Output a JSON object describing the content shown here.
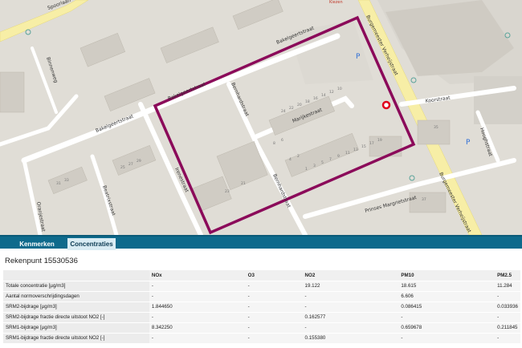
{
  "map": {
    "streets": {
      "bakelgeertstraat_top": "Bakelgeertstraat",
      "bakelgeertstraat_mid": "Bakelgeertstraat",
      "bakelgeertstraat_left": "Bakelgeertstraat",
      "bernhardstraat": "Bernhardstraat",
      "bernhardstraat_south": "Bernhardstraat",
      "marijkestraat": "Marijkestraat",
      "burgemeester_verheijstraat_north": "Burgemeester Verheijstraat",
      "burgemeester_verheijstraat_south": "Burgemeester Verheijstraat",
      "koorstraat": "Koorstraat",
      "prinses_margrietstraat": "Prinses Margrietstraat",
      "irenestraat": "Irenestraat",
      "beatrixstraat": "Beatrixstraat",
      "oranjestraat": "Oranjestraat",
      "binnenweg": "Binnenweg",
      "hooghstraat": "Hooghstraat",
      "spoorlaan": "Spoorlaan"
    },
    "parking_label": "P",
    "poi_label": "Kiezen",
    "selection_color": "#8b0a5a",
    "marker_color": "#e0001b",
    "house_numbers": [
      "24",
      "22",
      "20",
      "18",
      "16",
      "14",
      "12",
      "10",
      "8",
      "6",
      "4",
      "2",
      "1",
      "3",
      "5",
      "7",
      "9",
      "11",
      "13",
      "15",
      "17",
      "19",
      "21",
      "23",
      "25",
      "27",
      "29",
      "31",
      "33",
      "35",
      "37"
    ]
  },
  "tabs": {
    "kenmerken": "Kenmerken",
    "concentraties": "Concentraties",
    "active": "Concentraties"
  },
  "rekenpunt": "Rekenpunt 15530536",
  "table": {
    "columns": [
      "",
      "NOx",
      "O3",
      "NO2",
      "PM10",
      "PM2.5"
    ],
    "rows": [
      {
        "label": "Totale concentratie [µg/m3]",
        "values": [
          "-",
          "-",
          "19.122",
          "18.615",
          "11.284"
        ]
      },
      {
        "label": "Aantal normoverschrijdingsdagen",
        "values": [
          "-",
          "-",
          "-",
          "6.606",
          "-"
        ]
      },
      {
        "label": "SRM2-bijdrage [µg/m3]",
        "values": [
          "1.844650",
          "-",
          "-",
          "0.086415",
          "0.033936"
        ]
      },
      {
        "label": "SRM2-bijdrage fractie directe uitstoot NO2 [-]",
        "values": [
          "-",
          "-",
          "0.162577",
          "-",
          "-"
        ]
      },
      {
        "label": "SRM1-bijdrage [µg/m3]",
        "values": [
          "8.342250",
          "-",
          "-",
          "0.659678",
          "0.211845"
        ]
      },
      {
        "label": "SRM1-bijdrage fractie directe uitstoot NO2 [-]",
        "values": [
          "-",
          "-",
          "0.155380",
          "-",
          "-"
        ]
      }
    ]
  }
}
